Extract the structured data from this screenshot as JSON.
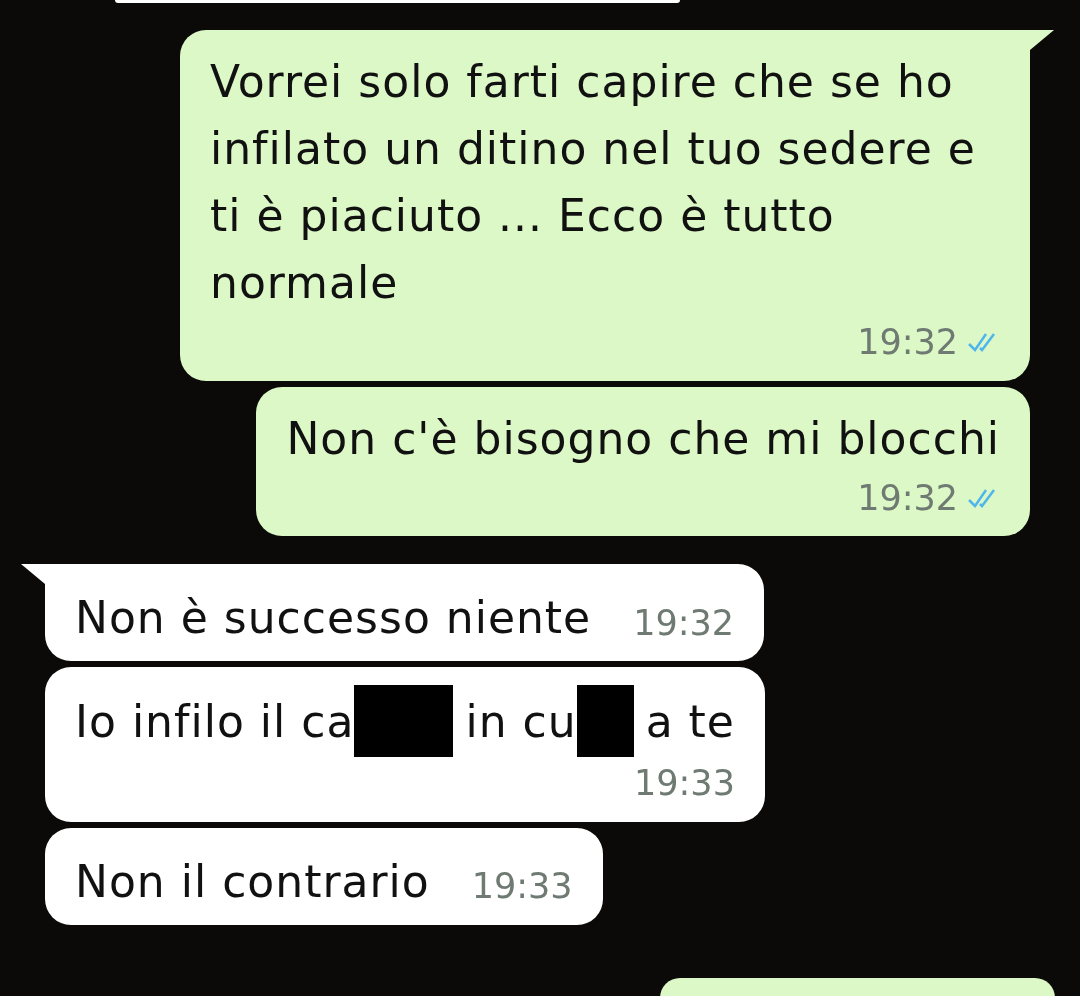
{
  "partial_bubbles": [
    {
      "kind": "incoming"
    },
    {
      "kind": "outgoing"
    }
  ],
  "messages": [
    {
      "kind": "outgoing",
      "tail": true,
      "text": "Vorrei solo farti capire che se ho infilato un ditino nel tuo sedere e ti è piaciuto ... Ecco è tutto normale",
      "time": "19:32",
      "read": true
    },
    {
      "kind": "outgoing",
      "tail": false,
      "text": "Non c'è bisogno che mi blocchi",
      "time": "19:32",
      "read": true
    },
    {
      "kind": "incoming",
      "tail": true,
      "text": "Non è successo niente",
      "time": "19:32"
    },
    {
      "kind": "incoming",
      "tail": false,
      "segments": [
        {
          "kind": "text",
          "text": "Io infilo il ca"
        },
        {
          "kind": "redaction"
        },
        {
          "kind": "text",
          "text": "in cu"
        },
        {
          "kind": "redaction"
        },
        {
          "kind": "text",
          "text": "a te"
        }
      ],
      "time": "19:33"
    },
    {
      "kind": "incoming",
      "tail": false,
      "text": "Non il contrario",
      "time": "19:33"
    }
  ]
}
